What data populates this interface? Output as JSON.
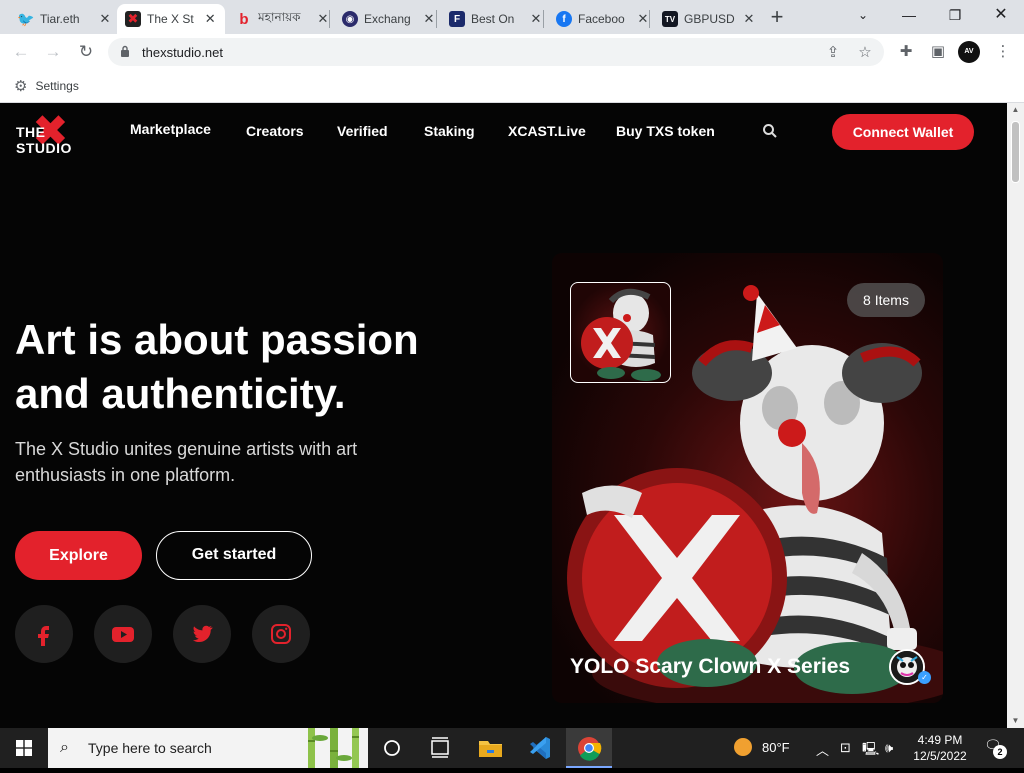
{
  "browser": {
    "tabs": [
      {
        "title": "Tiar.eth",
        "favicon": "twitter-icon",
        "color": "#1d9bf0",
        "glyph": "t"
      },
      {
        "title": "The X St",
        "favicon": "thexstudio-icon",
        "color": "#e3222c",
        "glyph": "X"
      },
      {
        "title": "মহানায়ক",
        "favicon": "b-icon",
        "color": "#ffffff",
        "glyph": "b"
      },
      {
        "title": "Exchang",
        "favicon": "exchange-icon",
        "color": "#3a3a8a",
        "glyph": "e"
      },
      {
        "title": "Best On",
        "favicon": "forex-icon",
        "color": "#1b2a6b",
        "glyph": "F"
      },
      {
        "title": "Faceboo",
        "favicon": "facebook-icon",
        "color": "#1877f2",
        "glyph": "f"
      },
      {
        "title": "GBPUSD",
        "favicon": "tradingview-icon",
        "color": "#131722",
        "glyph": "TV"
      }
    ],
    "url": "thexstudio.net",
    "bookmark": "Settings",
    "profile_text": "AV NEWS"
  },
  "site": {
    "logo_text": "THE STUDIO",
    "nav": [
      "Marketplace",
      "Creators",
      "Verified",
      "Staking",
      "XCAST.Live",
      "Buy TXS token"
    ],
    "connect_wallet": "Connect Wallet",
    "hero_title_line1": "Art is about passion",
    "hero_title_line2": "and authenticity.",
    "hero_subtitle": "The X Studio unites genuine artists with art enthusiasts in one platform.",
    "explore": "Explore",
    "get_started": "Get started",
    "socials": [
      "facebook-icon",
      "youtube-icon",
      "twitter-icon",
      "instagram-icon"
    ],
    "card": {
      "items_badge": "8 Items",
      "title": "YOLO Scary Clown X Series"
    },
    "accent": "#e3222c"
  },
  "taskbar": {
    "search_placeholder": "Type here to search",
    "temperature": "80°F",
    "time": "4:49 PM",
    "date": "12/5/2022",
    "notifications": "2"
  }
}
